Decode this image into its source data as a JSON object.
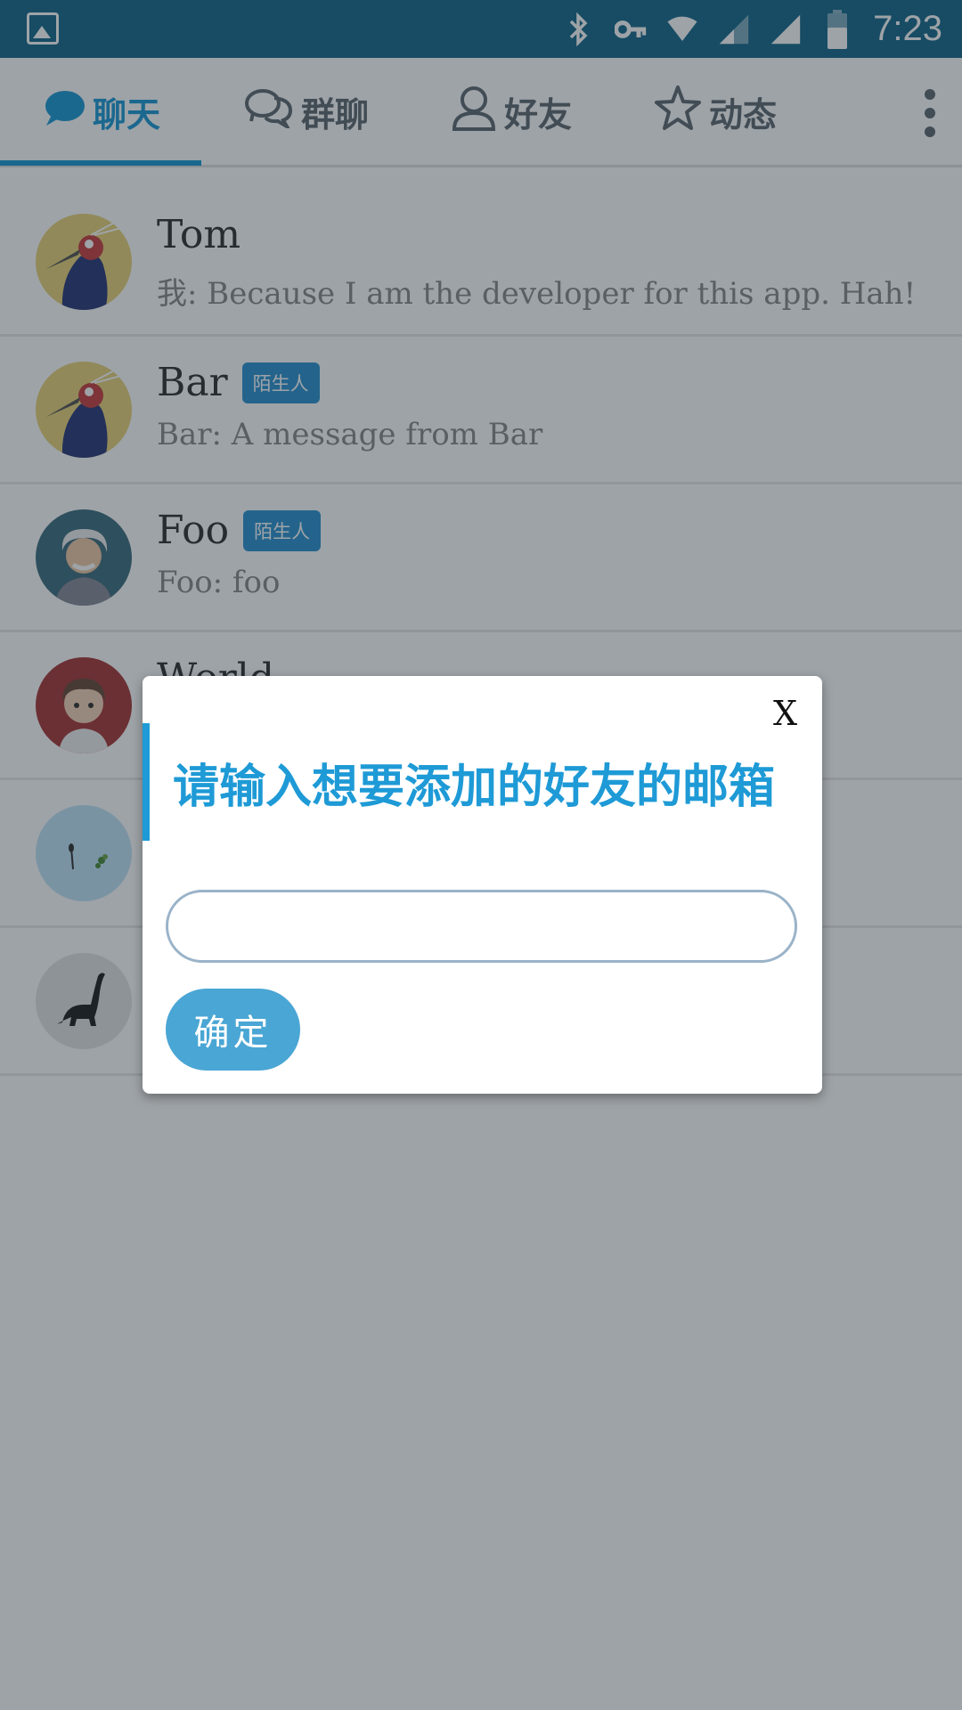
{
  "status_bar": {
    "time": "7:23",
    "icons": [
      "image-icon",
      "bluetooth-icon",
      "vpn-key-icon",
      "wifi-icon",
      "cell-signal-icon",
      "cell-signal-icon",
      "battery-icon"
    ],
    "background": "#186a8c"
  },
  "tabs": [
    {
      "label": "聊天",
      "icon": "chat-bubble-icon",
      "active": true
    },
    {
      "label": "群聊",
      "icon": "group-chat-icon",
      "active": false
    },
    {
      "label": "好友",
      "icon": "person-icon",
      "active": false
    },
    {
      "label": "动态",
      "icon": "star-icon",
      "active": false
    }
  ],
  "menu": {
    "icon": "more-vertical-icon"
  },
  "conversations": [
    {
      "name": "Tom",
      "badge": "",
      "message": "我: Because I am the developer for this app. Hah!"
    },
    {
      "name": "Bar",
      "badge": "陌生人",
      "message": "Bar: A message from Bar"
    },
    {
      "name": "Foo",
      "badge": "陌生人",
      "message": "Foo: foo"
    },
    {
      "name": "World",
      "badge": "",
      "message": ""
    },
    {
      "name": "",
      "badge": "",
      "message": ""
    },
    {
      "name": "",
      "badge": "",
      "message": ""
    }
  ],
  "dialog": {
    "close_label": "X",
    "title": "请输入想要添加的好友的邮箱",
    "email_value": "",
    "email_placeholder": "",
    "confirm_label": "确定"
  },
  "colors": {
    "accent": "#1e9ad6",
    "badge": "#2e93d1",
    "button": "#4aa6d4"
  }
}
